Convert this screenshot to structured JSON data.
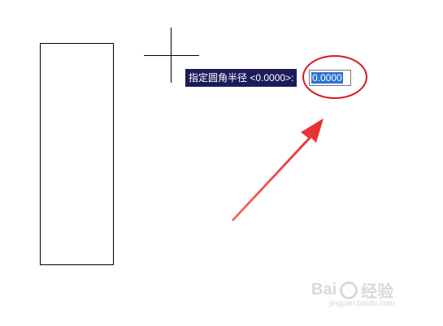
{
  "command_prompt": {
    "label": "指定圆角半径 <0.0000>:",
    "input_value": "0.0000"
  },
  "watermark": {
    "brand": "Bai",
    "brand_suffix": "经验",
    "url": "jingyan.baidu.com"
  },
  "colors": {
    "prompt_bg": "#1c1c5c",
    "selection": "#2b72d6",
    "annotation_red": "#d61a1a",
    "arrow_red": "#ef3b3b"
  }
}
